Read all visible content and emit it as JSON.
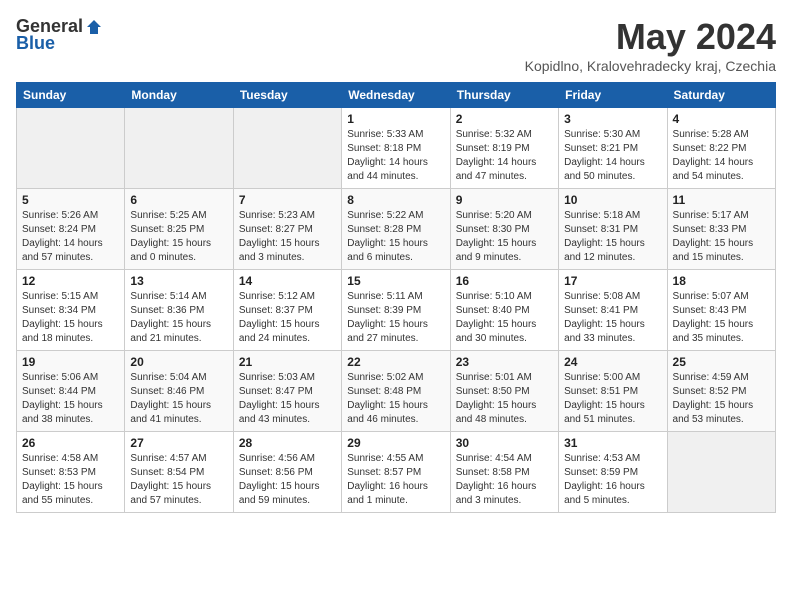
{
  "header": {
    "logo_general": "General",
    "logo_blue": "Blue",
    "month_title": "May 2024",
    "subtitle": "Kopidlno, Kralovehradecky kraj, Czechia"
  },
  "weekdays": [
    "Sunday",
    "Monday",
    "Tuesday",
    "Wednesday",
    "Thursday",
    "Friday",
    "Saturday"
  ],
  "weeks": [
    [
      {
        "day": "",
        "sunrise": "",
        "sunset": "",
        "daylight": ""
      },
      {
        "day": "",
        "sunrise": "",
        "sunset": "",
        "daylight": ""
      },
      {
        "day": "",
        "sunrise": "",
        "sunset": "",
        "daylight": ""
      },
      {
        "day": "1",
        "sunrise": "Sunrise: 5:33 AM",
        "sunset": "Sunset: 8:18 PM",
        "daylight": "Daylight: 14 hours and 44 minutes."
      },
      {
        "day": "2",
        "sunrise": "Sunrise: 5:32 AM",
        "sunset": "Sunset: 8:19 PM",
        "daylight": "Daylight: 14 hours and 47 minutes."
      },
      {
        "day": "3",
        "sunrise": "Sunrise: 5:30 AM",
        "sunset": "Sunset: 8:21 PM",
        "daylight": "Daylight: 14 hours and 50 minutes."
      },
      {
        "day": "4",
        "sunrise": "Sunrise: 5:28 AM",
        "sunset": "Sunset: 8:22 PM",
        "daylight": "Daylight: 14 hours and 54 minutes."
      }
    ],
    [
      {
        "day": "5",
        "sunrise": "Sunrise: 5:26 AM",
        "sunset": "Sunset: 8:24 PM",
        "daylight": "Daylight: 14 hours and 57 minutes."
      },
      {
        "day": "6",
        "sunrise": "Sunrise: 5:25 AM",
        "sunset": "Sunset: 8:25 PM",
        "daylight": "Daylight: 15 hours and 0 minutes."
      },
      {
        "day": "7",
        "sunrise": "Sunrise: 5:23 AM",
        "sunset": "Sunset: 8:27 PM",
        "daylight": "Daylight: 15 hours and 3 minutes."
      },
      {
        "day": "8",
        "sunrise": "Sunrise: 5:22 AM",
        "sunset": "Sunset: 8:28 PM",
        "daylight": "Daylight: 15 hours and 6 minutes."
      },
      {
        "day": "9",
        "sunrise": "Sunrise: 5:20 AM",
        "sunset": "Sunset: 8:30 PM",
        "daylight": "Daylight: 15 hours and 9 minutes."
      },
      {
        "day": "10",
        "sunrise": "Sunrise: 5:18 AM",
        "sunset": "Sunset: 8:31 PM",
        "daylight": "Daylight: 15 hours and 12 minutes."
      },
      {
        "day": "11",
        "sunrise": "Sunrise: 5:17 AM",
        "sunset": "Sunset: 8:33 PM",
        "daylight": "Daylight: 15 hours and 15 minutes."
      }
    ],
    [
      {
        "day": "12",
        "sunrise": "Sunrise: 5:15 AM",
        "sunset": "Sunset: 8:34 PM",
        "daylight": "Daylight: 15 hours and 18 minutes."
      },
      {
        "day": "13",
        "sunrise": "Sunrise: 5:14 AM",
        "sunset": "Sunset: 8:36 PM",
        "daylight": "Daylight: 15 hours and 21 minutes."
      },
      {
        "day": "14",
        "sunrise": "Sunrise: 5:12 AM",
        "sunset": "Sunset: 8:37 PM",
        "daylight": "Daylight: 15 hours and 24 minutes."
      },
      {
        "day": "15",
        "sunrise": "Sunrise: 5:11 AM",
        "sunset": "Sunset: 8:39 PM",
        "daylight": "Daylight: 15 hours and 27 minutes."
      },
      {
        "day": "16",
        "sunrise": "Sunrise: 5:10 AM",
        "sunset": "Sunset: 8:40 PM",
        "daylight": "Daylight: 15 hours and 30 minutes."
      },
      {
        "day": "17",
        "sunrise": "Sunrise: 5:08 AM",
        "sunset": "Sunset: 8:41 PM",
        "daylight": "Daylight: 15 hours and 33 minutes."
      },
      {
        "day": "18",
        "sunrise": "Sunrise: 5:07 AM",
        "sunset": "Sunset: 8:43 PM",
        "daylight": "Daylight: 15 hours and 35 minutes."
      }
    ],
    [
      {
        "day": "19",
        "sunrise": "Sunrise: 5:06 AM",
        "sunset": "Sunset: 8:44 PM",
        "daylight": "Daylight: 15 hours and 38 minutes."
      },
      {
        "day": "20",
        "sunrise": "Sunrise: 5:04 AM",
        "sunset": "Sunset: 8:46 PM",
        "daylight": "Daylight: 15 hours and 41 minutes."
      },
      {
        "day": "21",
        "sunrise": "Sunrise: 5:03 AM",
        "sunset": "Sunset: 8:47 PM",
        "daylight": "Daylight: 15 hours and 43 minutes."
      },
      {
        "day": "22",
        "sunrise": "Sunrise: 5:02 AM",
        "sunset": "Sunset: 8:48 PM",
        "daylight": "Daylight: 15 hours and 46 minutes."
      },
      {
        "day": "23",
        "sunrise": "Sunrise: 5:01 AM",
        "sunset": "Sunset: 8:50 PM",
        "daylight": "Daylight: 15 hours and 48 minutes."
      },
      {
        "day": "24",
        "sunrise": "Sunrise: 5:00 AM",
        "sunset": "Sunset: 8:51 PM",
        "daylight": "Daylight: 15 hours and 51 minutes."
      },
      {
        "day": "25",
        "sunrise": "Sunrise: 4:59 AM",
        "sunset": "Sunset: 8:52 PM",
        "daylight": "Daylight: 15 hours and 53 minutes."
      }
    ],
    [
      {
        "day": "26",
        "sunrise": "Sunrise: 4:58 AM",
        "sunset": "Sunset: 8:53 PM",
        "daylight": "Daylight: 15 hours and 55 minutes."
      },
      {
        "day": "27",
        "sunrise": "Sunrise: 4:57 AM",
        "sunset": "Sunset: 8:54 PM",
        "daylight": "Daylight: 15 hours and 57 minutes."
      },
      {
        "day": "28",
        "sunrise": "Sunrise: 4:56 AM",
        "sunset": "Sunset: 8:56 PM",
        "daylight": "Daylight: 15 hours and 59 minutes."
      },
      {
        "day": "29",
        "sunrise": "Sunrise: 4:55 AM",
        "sunset": "Sunset: 8:57 PM",
        "daylight": "Daylight: 16 hours and 1 minute."
      },
      {
        "day": "30",
        "sunrise": "Sunrise: 4:54 AM",
        "sunset": "Sunset: 8:58 PM",
        "daylight": "Daylight: 16 hours and 3 minutes."
      },
      {
        "day": "31",
        "sunrise": "Sunrise: 4:53 AM",
        "sunset": "Sunset: 8:59 PM",
        "daylight": "Daylight: 16 hours and 5 minutes."
      },
      {
        "day": "",
        "sunrise": "",
        "sunset": "",
        "daylight": ""
      }
    ]
  ]
}
